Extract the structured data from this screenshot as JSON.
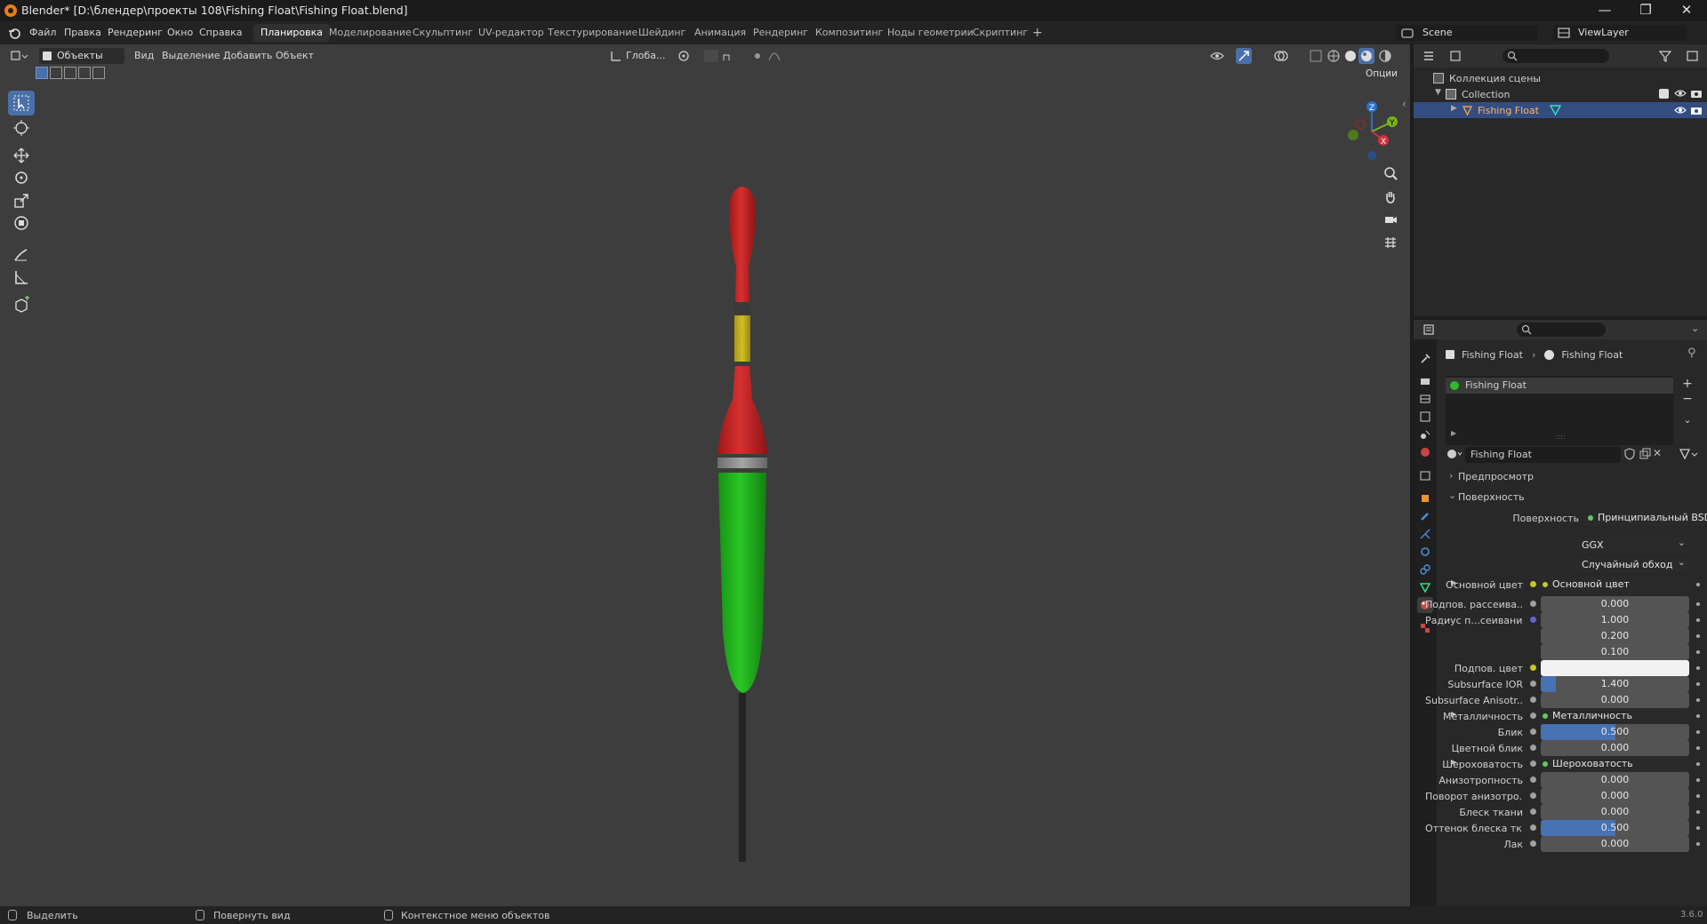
{
  "window": {
    "title": "Blender* [D:\\блендер\\проекты 108\\Fishing Float\\Fishing Float.blend]",
    "controls": [
      "—",
      "❐",
      "✕"
    ]
  },
  "menu": {
    "items": [
      "Файл",
      "Правка",
      "Рендеринг",
      "Окно",
      "Справка"
    ]
  },
  "workspaces": {
    "tabs": [
      "Планировка",
      "Моделирование",
      "Скульптинг",
      "UV-редактор",
      "Текстурирование",
      "Шейдинг",
      "Анимация",
      "Рендеринг",
      "Композитинг",
      "Ноды геометрии",
      "Скриптинг",
      "+"
    ],
    "active": "Планировка"
  },
  "scene": {
    "label": "Scene"
  },
  "view_layer": {
    "label": "ViewLayer"
  },
  "viewport_header": {
    "mode": "Объекты",
    "menus": [
      "Вид",
      "Выделение",
      "Добавить",
      "Объект"
    ],
    "orientation": "Глоба...",
    "options": "Опции"
  },
  "outliner": {
    "scene_collection": "Коллекция сцены",
    "collection": "Collection",
    "object": "Fishing Float"
  },
  "properties": {
    "breadcrumb": [
      "Fishing Float",
      "Fishing Float"
    ],
    "material_slot": "Fishing Float",
    "material_name": "Fishing Float",
    "panel_preview": "Предпросмотр",
    "panel_surface": "Поверхность",
    "surface_label": "Поверхность",
    "surface_shader": "Принципиальный BSDF",
    "distribution": "GGX",
    "subsurface_method": "Случайный обход",
    "rows": [
      {
        "label": "Основной цвет",
        "kind": "link",
        "value": "Основной цвет",
        "dot": "#c7c729",
        "expand": true
      },
      {
        "label": "Подпов. рассеива...",
        "kind": "num",
        "value": "0.000",
        "dot": "#a1a1a1"
      },
      {
        "label": "Радиус п...сеивания",
        "kind": "num",
        "value": "1.000",
        "dot": "#6363c7"
      },
      {
        "label": "",
        "kind": "num",
        "value": "0.200"
      },
      {
        "label": "",
        "kind": "num",
        "value": "0.100"
      },
      {
        "label": "Подпов. цвет",
        "kind": "color",
        "value": "",
        "dot": "#c7c729"
      },
      {
        "label": "Subsurface IOR",
        "kind": "num",
        "value": "1.400",
        "dot": "#a1a1a1",
        "fill": 0.1
      },
      {
        "label": "Subsurface Anisotr...",
        "kind": "num",
        "value": "0.000",
        "dot": "#a1a1a1"
      },
      {
        "label": "Металличность",
        "kind": "link",
        "value": "Металличность",
        "dot": "#a1a1a1",
        "expand": true
      },
      {
        "label": "Блик",
        "kind": "num",
        "value": "0.500",
        "dot": "#a1a1a1",
        "fill": 0.5
      },
      {
        "label": "Цветной блик",
        "kind": "num",
        "value": "0.000",
        "dot": "#a1a1a1"
      },
      {
        "label": "Шероховатость",
        "kind": "link",
        "value": "Шероховатость",
        "dot": "#a1a1a1",
        "expand": true
      },
      {
        "label": "Анизотропность",
        "kind": "num",
        "value": "0.000",
        "dot": "#a1a1a1"
      },
      {
        "label": "Поворот анизотро...",
        "kind": "num",
        "value": "0.000",
        "dot": "#a1a1a1"
      },
      {
        "label": "Блеск ткани",
        "kind": "num",
        "value": "0.000",
        "dot": "#a1a1a1"
      },
      {
        "label": "Оттенок блеска тк...",
        "kind": "num",
        "value": "0.500",
        "dot": "#a1a1a1",
        "fill": 0.5
      },
      {
        "label": "Лак",
        "kind": "num",
        "value": "0.000",
        "dot": "#a1a1a1"
      }
    ]
  },
  "status": {
    "select": "Выделить",
    "rotate": "Повернуть вид",
    "context": "Контекстное меню объектов",
    "version": "3.6.0"
  },
  "colors": {
    "accent": "#4772b3",
    "float_red": "#cc2121",
    "float_green": "#22b01e",
    "float_yellow": "#c7b41c"
  }
}
